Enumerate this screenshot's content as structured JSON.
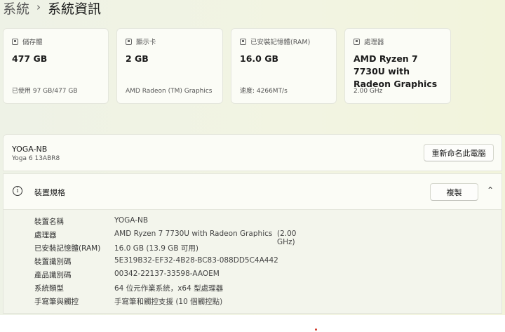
{
  "breadcrumb": {
    "parent": "系統",
    "separator": "›",
    "current": "系統資訊"
  },
  "cards": [
    {
      "icon": "storage-icon",
      "label": "儲存體",
      "value": "477 GB",
      "sub": "已使用 97 GB/477 GB"
    },
    {
      "icon": "gpu-icon",
      "label": "顯示卡",
      "value": "2 GB",
      "sub": "AMD Radeon (TM) Graphics"
    },
    {
      "icon": "ram-icon",
      "label": "已安裝記憶體(RAM)",
      "value": "16.0 GB",
      "sub": "速度: 4266MT/s"
    },
    {
      "icon": "cpu-icon",
      "label": "處理器",
      "value": "AMD Ryzen 7 7730U with Radeon Graphics",
      "sub": "2.00 GHz"
    }
  ],
  "device": {
    "name": "YOGA-NB",
    "model": "Yoga 6 13ABR8",
    "rename_label": "重新命名此電腦"
  },
  "specs": {
    "title": "裝置規格",
    "copy_label": "複製",
    "rows": [
      {
        "key": "裝置名稱",
        "value": "YOGA-NB"
      },
      {
        "key": "處理器",
        "value": "AMD Ryzen 7 7730U with Radeon Graphics",
        "value2": "(2.00 GHz)"
      },
      {
        "key": "已安裝記憶體(RAM)",
        "value": "16.0 GB (13.9 GB 可用)"
      },
      {
        "key": "裝置識別碼",
        "value": "5E319B32-EF32-4B28-BC83-088DD5C4A442"
      },
      {
        "key": "產品識別碼",
        "value": "00342-22137-33598-AAOEM"
      },
      {
        "key": "系統類型",
        "value": "64 位元作業系統，x64 型處理器"
      },
      {
        "key": "手寫筆與觸控",
        "value": "手寫筆和觸控支援 (10 個觸控點)"
      }
    ]
  }
}
